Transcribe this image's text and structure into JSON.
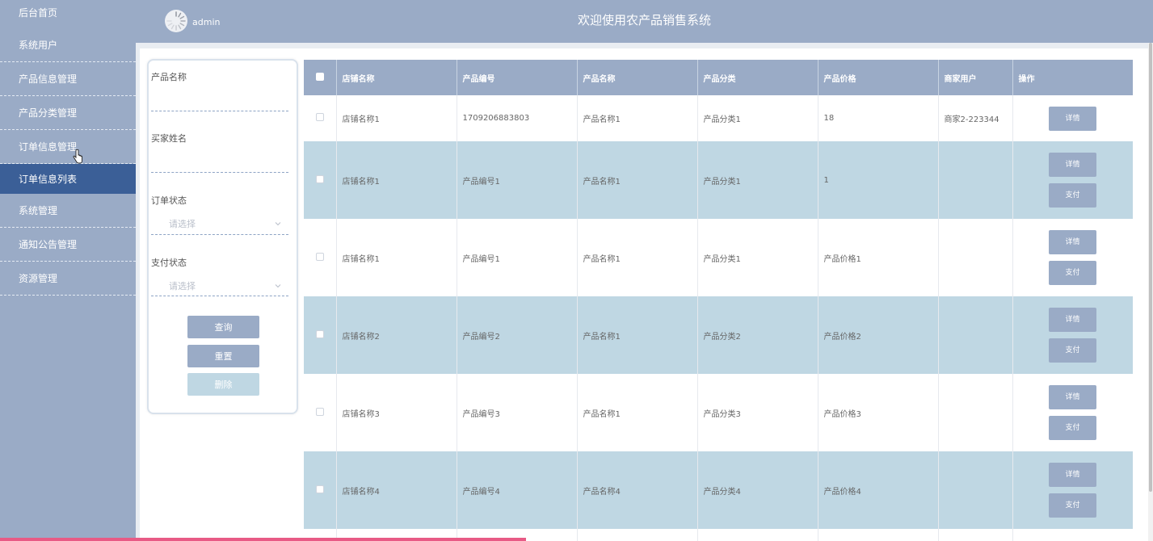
{
  "sidebar": {
    "items": [
      {
        "label": "后台首页"
      },
      {
        "label": "系统用户"
      },
      {
        "label": "产品信息管理"
      },
      {
        "label": "产品分类管理"
      },
      {
        "label": "订单信息管理"
      },
      {
        "label": "订单信息列表"
      },
      {
        "label": "系统管理"
      },
      {
        "label": "通知公告管理"
      },
      {
        "label": "资源管理"
      }
    ]
  },
  "header": {
    "username": "admin",
    "title": "欢迎使用农产品销售系统"
  },
  "search": {
    "product_name_label": "产品名称",
    "buyer_name_label": "买家姓名",
    "order_status_label": "订单状态",
    "order_status_placeholder": "请选择",
    "pay_status_label": "支付状态",
    "pay_status_placeholder": "请选择",
    "query_label": "查询",
    "reset_label": "重置",
    "delete_label": "删除"
  },
  "table": {
    "headers": [
      "店铺名称",
      "产品编号",
      "产品名称",
      "产品分类",
      "产品价格",
      "商家用户",
      "操作"
    ],
    "detail_label": "详情",
    "pay_label": "支付",
    "rows": [
      {
        "shop": "店铺名称1",
        "code": "1709206883803",
        "name": "产品名称1",
        "category": "产品分类1",
        "price": "18",
        "merchant": "商家2-223344"
      },
      {
        "shop": "店铺名称1",
        "code": "产品编号1",
        "name": "产品名称1",
        "category": "产品分类1",
        "price": "1",
        "merchant": ""
      },
      {
        "shop": "店铺名称1",
        "code": "产品编号1",
        "name": "产品名称1",
        "category": "产品分类1",
        "price": "产品价格1",
        "merchant": ""
      },
      {
        "shop": "店铺名称2",
        "code": "产品编号2",
        "name": "产品名称1",
        "category": "产品分类2",
        "price": "产品价格2",
        "merchant": ""
      },
      {
        "shop": "店铺名称3",
        "code": "产品编号3",
        "name": "产品名称1",
        "category": "产品分类3",
        "price": "产品价格3",
        "merchant": ""
      },
      {
        "shop": "店铺名称4",
        "code": "产品编号4",
        "name": "产品名称4",
        "category": "产品分类4",
        "price": "产品价格4",
        "merchant": ""
      }
    ]
  },
  "colors": {
    "sidebar_bg": "#9aabc6",
    "active_nav": "#3b5f97",
    "row_alt": "#bfd7e3",
    "button": "#9aabc6"
  }
}
